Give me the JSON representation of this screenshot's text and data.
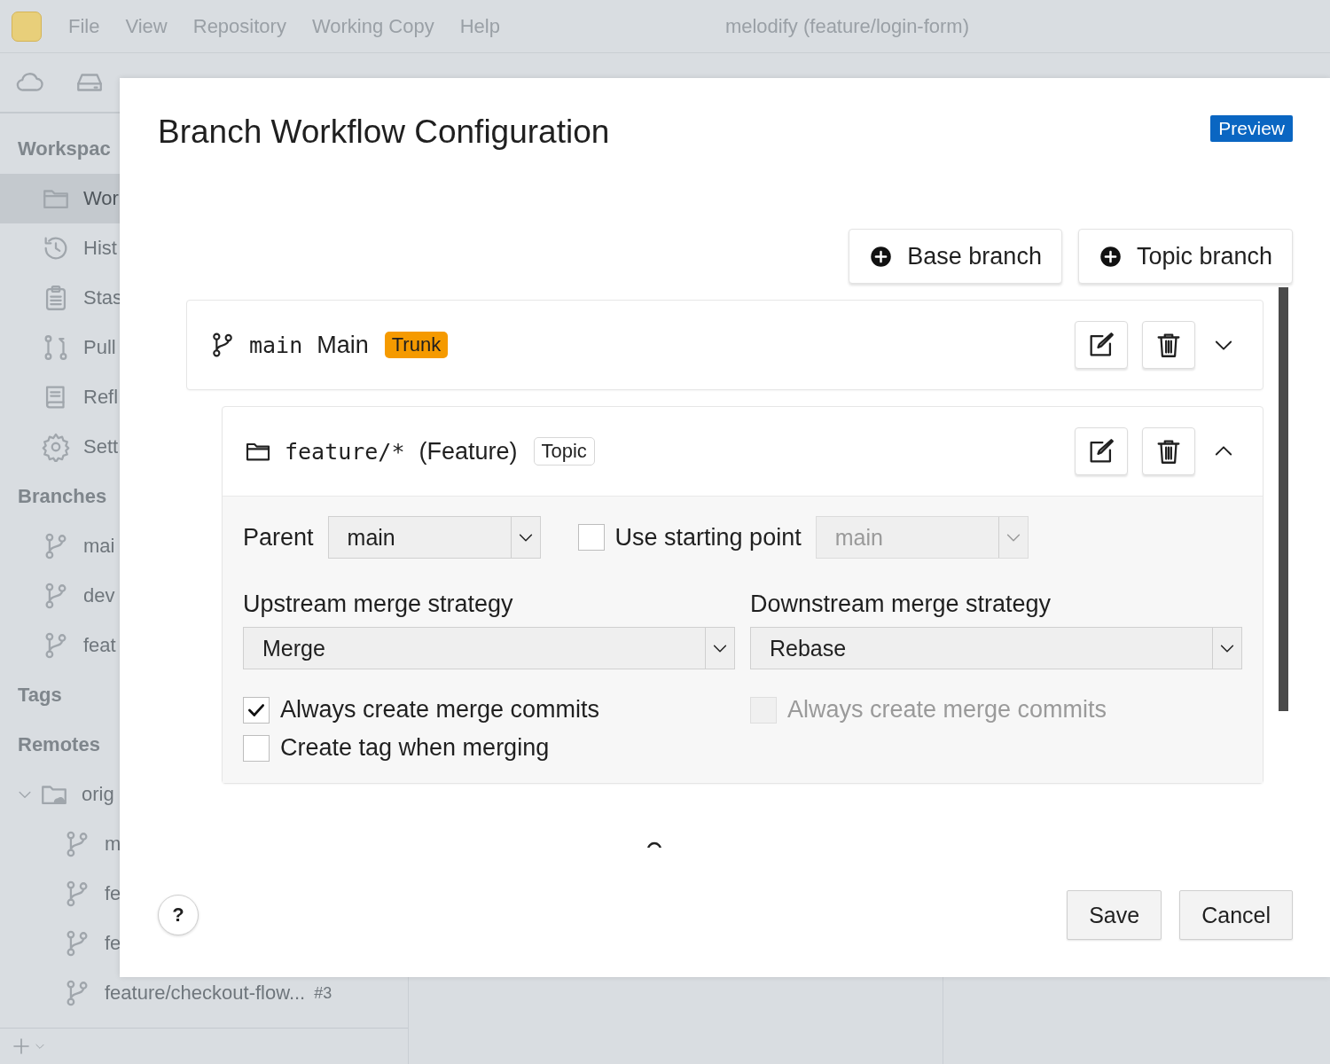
{
  "window": {
    "title": "melodify (feature/login-form)"
  },
  "menu": [
    "File",
    "View",
    "Repository",
    "Working Copy",
    "Help"
  ],
  "sidebar": {
    "sections": [
      {
        "title": "Workspac",
        "items": [
          {
            "label": "Wor",
            "kind": "folder",
            "selected": true
          },
          {
            "label": "Hist",
            "kind": "history",
            "selected": false
          },
          {
            "label": "Stas",
            "kind": "clipboard",
            "selected": false
          },
          {
            "label": "Pull",
            "kind": "pull",
            "selected": false
          },
          {
            "label": "Refl",
            "kind": "book",
            "selected": false
          },
          {
            "label": "Sett",
            "kind": "gear",
            "selected": false
          }
        ]
      },
      {
        "title": "Branches",
        "items": [
          {
            "label": "mai",
            "kind": "branch",
            "selected": false
          },
          {
            "label": "dev",
            "kind": "branch",
            "selected": false
          },
          {
            "label": "feat",
            "kind": "branch",
            "selected": false
          }
        ]
      },
      {
        "title": "Tags"
      },
      {
        "title": "Remotes",
        "items": [
          {
            "label": "orig",
            "kind": "remote",
            "selected": false,
            "expanded": true,
            "children": [
              {
                "label": "m",
                "kind": "branch",
                "selected": false
              },
              {
                "label": "fe",
                "kind": "branch",
                "selected": false
              },
              {
                "label": "fe",
                "kind": "branch",
                "selected": false
              },
              {
                "label": "feature/checkout-flow...",
                "badge": "#3",
                "kind": "branch",
                "selected": false
              }
            ]
          }
        ]
      }
    ]
  },
  "dialog": {
    "title": "Branch Workflow Configuration",
    "badge": "Preview",
    "actions": [
      {
        "label": "Base branch"
      },
      {
        "label": "Topic branch"
      }
    ],
    "branches": [
      {
        "kind": "base",
        "name": "main",
        "display": "Main",
        "tag": "Trunk",
        "expanded": false
      },
      {
        "kind": "topic",
        "name": "feature/*",
        "display": "(Feature)",
        "tag": "Topic",
        "expanded": true,
        "settings": {
          "parent": {
            "label": "Parent",
            "value": "main"
          },
          "starting_point": {
            "label": "Use starting point",
            "checked": false,
            "value": "main"
          },
          "upstream": {
            "label": "Upstream merge strategy",
            "value": "Merge",
            "options": [
              {
                "label": "Always create merge commits",
                "checked": true,
                "disabled": false
              },
              {
                "label": "Create tag when merging",
                "checked": false,
                "disabled": false
              }
            ]
          },
          "downstream": {
            "label": "Downstream merge strategy",
            "value": "Rebase",
            "options": [
              {
                "label": "Always create merge commits",
                "checked": false,
                "disabled": true
              }
            ]
          }
        }
      }
    ],
    "help": "?",
    "buttons": [
      "Save",
      "Cancel"
    ]
  }
}
